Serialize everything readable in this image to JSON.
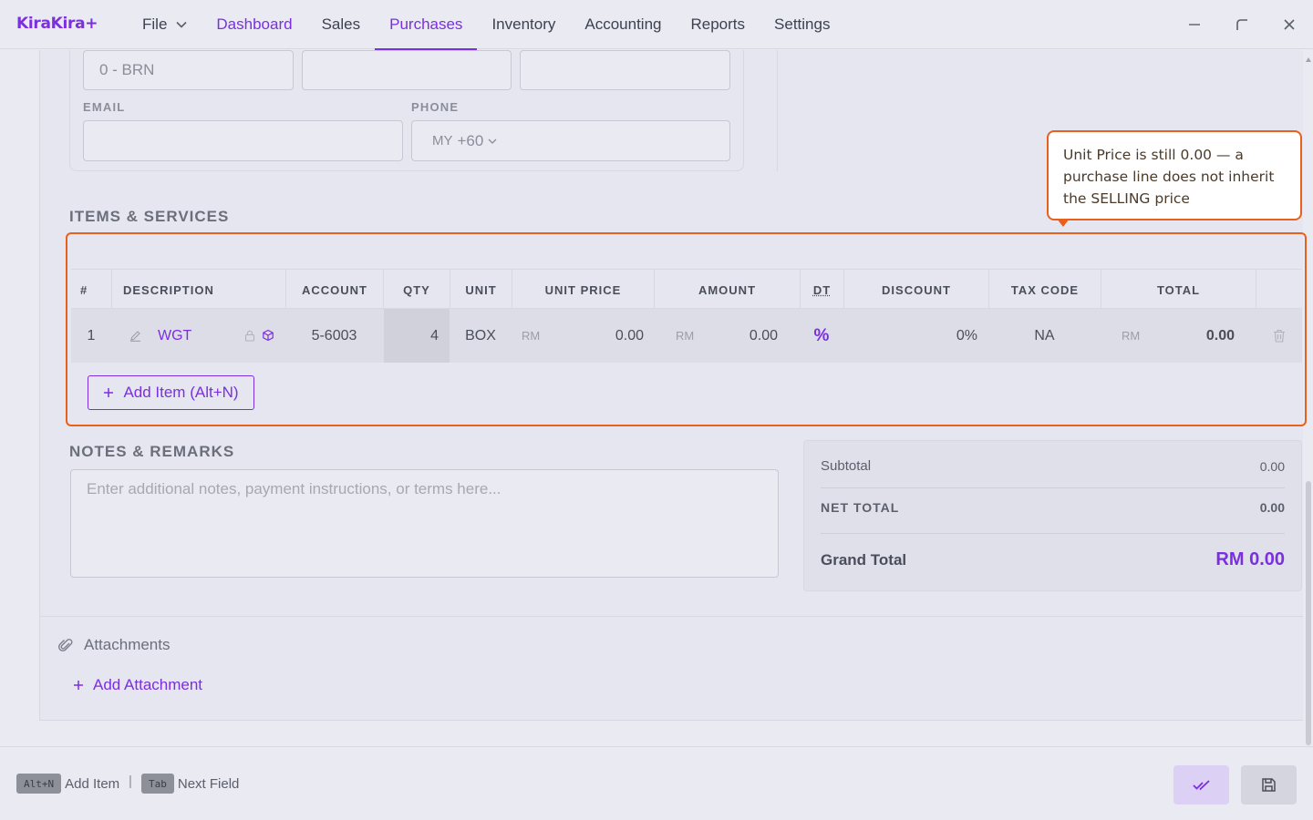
{
  "app": {
    "logo": "KiraKira+"
  },
  "menu": {
    "file": "File",
    "items": [
      "Dashboard",
      "Sales",
      "Purchases",
      "Inventory",
      "Accounting",
      "Reports",
      "Settings"
    ]
  },
  "supplier": {
    "brn_value": "0 - BRN",
    "email_label": "EMAIL",
    "phone_label": "PHONE",
    "phone_country": "MY",
    "phone_code": "+60"
  },
  "items_section": {
    "title": "ITEMS & SERVICES",
    "columns": [
      "#",
      "DESCRIPTION",
      "ACCOUNT",
      "QTY",
      "UNIT",
      "UNIT PRICE",
      "AMOUNT",
      "DT",
      "DISCOUNT",
      "TAX CODE",
      "TOTAL"
    ],
    "rows": [
      {
        "no": "1",
        "description": "WGT",
        "account": "5-6003",
        "qty": "4",
        "unit": "BOX",
        "unit_price_currency": "RM",
        "unit_price": "0.00",
        "amount_currency": "RM",
        "amount": "0.00",
        "dt": "%",
        "discount": "0%",
        "tax_code": "NA",
        "total_currency": "RM",
        "total": "0.00"
      }
    ],
    "add_item_label": "Add Item (Alt+N)"
  },
  "callout": {
    "text": "Unit Price is still 0.00 — a purchase line does not inherit the SELLING price",
    "accent": "#e8601c"
  },
  "notes": {
    "title": "NOTES & REMARKS",
    "placeholder": "Enter additional notes, payment instructions, or terms here..."
  },
  "totals": {
    "subtotal_label": "Subtotal",
    "subtotal_value": "0.00",
    "net_total_label": "NET TOTAL",
    "net_total_value": "0.00",
    "grand_total_label": "Grand Total",
    "grand_total_value": "RM 0.00"
  },
  "attachments": {
    "title": "Attachments",
    "add_label": "Add Attachment"
  },
  "footer": {
    "hints": [
      {
        "key": "Alt+N",
        "label": "Add Item"
      },
      {
        "key": "Tab",
        "label": "Next Field"
      }
    ],
    "separator": "|"
  },
  "colors": {
    "brand": "#7b2fe0",
    "highlight": "#e8601c"
  }
}
